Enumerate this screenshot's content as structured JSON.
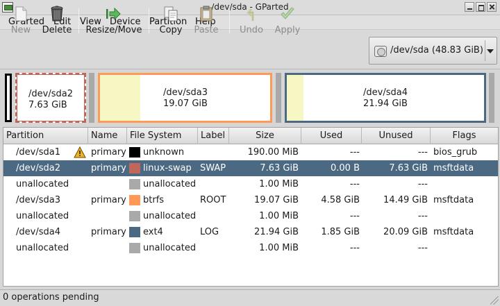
{
  "window": {
    "title": "/dev/sda - GParted"
  },
  "menu": [
    "GParted",
    "Edit",
    "View",
    "Device",
    "Partition",
    "Help"
  ],
  "toolbar": {
    "new": "New",
    "delete": "Delete",
    "resize_move": "Resize/Move",
    "copy": "Copy",
    "paste": "Paste",
    "undo": "Undo",
    "apply": "Apply"
  },
  "device": {
    "label": "/dev/sda  (48.83 GiB)"
  },
  "diskmap": [
    {
      "name": "/dev/sda2",
      "size": "7.63 GiB",
      "fs_color": "#c1665a"
    },
    {
      "name": "/dev/sda3",
      "size": "19.07 GiB",
      "fs_color": "#ff9955"
    },
    {
      "name": "/dev/sda4",
      "size": "21.94 GiB",
      "fs_color": "#4b6983"
    }
  ],
  "table": {
    "columns": [
      "Partition",
      "Name",
      "File System",
      "Label",
      "Size",
      "Used",
      "Unused",
      "Flags"
    ],
    "rows": [
      {
        "partition": "/dev/sda1",
        "name": "primary",
        "fs": "unknown",
        "fs_color": "#000000",
        "label": "",
        "size": "190.00 MiB",
        "used": "---",
        "unused": "---",
        "flags": "bios_grub",
        "warning": true
      },
      {
        "partition": "/dev/sda2",
        "name": "primary",
        "fs": "linux-swap",
        "fs_color": "#c1665a",
        "label": "SWAP",
        "size": "7.63 GiB",
        "used": "0.00 B",
        "unused": "7.63 GiB",
        "flags": "msftdata",
        "selected": true
      },
      {
        "partition": "unallocated",
        "name": "",
        "fs": "unallocated",
        "fs_color": "#a9a9a9",
        "label": "",
        "size": "1.00 MiB",
        "used": "---",
        "unused": "---",
        "flags": ""
      },
      {
        "partition": "/dev/sda3",
        "name": "primary",
        "fs": "btrfs",
        "fs_color": "#ff9955",
        "label": "ROOT",
        "size": "19.07 GiB",
        "used": "4.58 GiB",
        "unused": "14.49 GiB",
        "flags": "msftdata"
      },
      {
        "partition": "unallocated",
        "name": "",
        "fs": "unallocated",
        "fs_color": "#a9a9a9",
        "label": "",
        "size": "1.00 MiB",
        "used": "---",
        "unused": "---",
        "flags": ""
      },
      {
        "partition": "/dev/sda4",
        "name": "primary",
        "fs": "ext4",
        "fs_color": "#4b6983",
        "label": "LOG",
        "size": "21.94 GiB",
        "used": "1.85 GiB",
        "unused": "20.09 GiB",
        "flags": "msftdata"
      },
      {
        "partition": "unallocated",
        "name": "",
        "fs": "unallocated",
        "fs_color": "#a9a9a9",
        "label": "",
        "size": "1.00 MiB",
        "used": "---",
        "unused": "---",
        "flags": ""
      }
    ]
  },
  "status": {
    "text": "0 operations pending"
  }
}
